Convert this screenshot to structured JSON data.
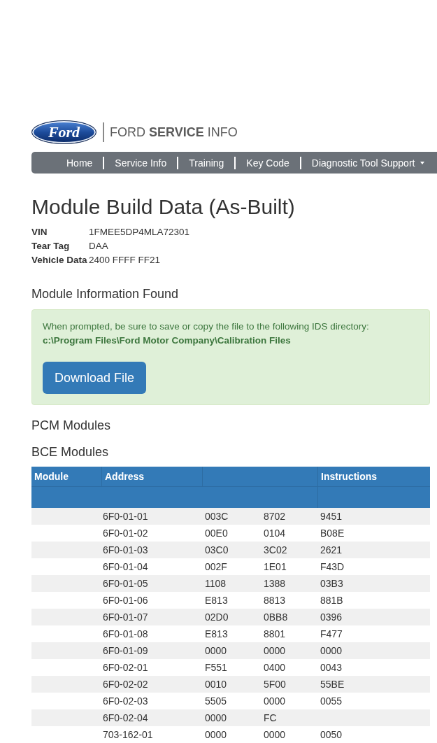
{
  "header": {
    "logo": {
      "emblem": "Ford",
      "wordmark": "FORD **SERVICE** INFO"
    },
    "nav": {
      "items": [
        {
          "label": "Home",
          "dropdown": false
        },
        {
          "label": "Service Info",
          "dropdown": false
        },
        {
          "label": "Training",
          "dropdown": false
        },
        {
          "label": "Key Code",
          "dropdown": false
        },
        {
          "label": "Diagnostic Tool Support",
          "dropdown": true
        }
      ]
    }
  },
  "page_title": "Module Build Data (As-Built)",
  "vehicle_info": [
    {
      "label": "VIN",
      "value": "1FMEE5DP4MLA72301"
    },
    {
      "label": "Tear Tag",
      "value": "DAA"
    },
    {
      "label": "Vehicle Data",
      "value": "2400 FFFF FF21"
    }
  ],
  "module_info": {
    "heading": "Module Information Found",
    "alert": {
      "message": "When prompted, be sure to save or copy the file to the following IDS directory:",
      "path": "c:\\Program Files\\Ford Motor Company\\Calibration Files",
      "button": "Download File"
    }
  },
  "sections": [
    {
      "heading": "PCM Modules"
    },
    {
      "heading": "BCE Modules",
      "table": {
        "columns": [
          {
            "kind": "text",
            "label": "Module"
          },
          {
            "kind": "text",
            "label": "Address"
          },
          {
            "kind": "blank"
          },
          {
            "kind": "text",
            "label": "Instructions"
          }
        ],
        "rows": [
          {
            "address": "6F0-01-01",
            "values": [
              "003C",
              "8702",
              "9451"
            ]
          },
          {
            "address": "6F0-01-02",
            "values": [
              "00E0",
              "0104",
              "B08E"
            ]
          },
          {
            "address": "6F0-01-03",
            "values": [
              "03C0",
              "3C02",
              "2621"
            ]
          },
          {
            "address": "6F0-01-04",
            "values": [
              "002F",
              "1E01",
              "F43D"
            ]
          },
          {
            "address": "6F0-01-05",
            "values": [
              "1108",
              "1388",
              "03B3"
            ]
          },
          {
            "address": "6F0-01-06",
            "values": [
              "E813",
              "8813",
              "881B"
            ]
          },
          {
            "address": "6F0-01-07",
            "values": [
              "02D0",
              "0BB8",
              "0396"
            ]
          },
          {
            "address": "6F0-01-08",
            "values": [
              "E813",
              "8801",
              "F477"
            ]
          },
          {
            "address": "6F0-01-09",
            "values": [
              "0000",
              "0000",
              "0000"
            ]
          },
          {
            "address": "6F0-02-01",
            "values": [
              "F551",
              "0400",
              "0043"
            ]
          },
          {
            "address": "6F0-02-02",
            "values": [
              "0010",
              "5F00",
              "55BE"
            ]
          },
          {
            "address": "6F0-02-03",
            "values": [
              "5505",
              "0000",
              "0055"
            ]
          },
          {
            "address": "6F0-02-04",
            "values": [
              "0000",
              "FC"
            ]
          },
          {
            "address": "703-162-01",
            "values": [
              "0000",
              "0000",
              "0050"
            ]
          }
        ]
      }
    }
  ]
}
